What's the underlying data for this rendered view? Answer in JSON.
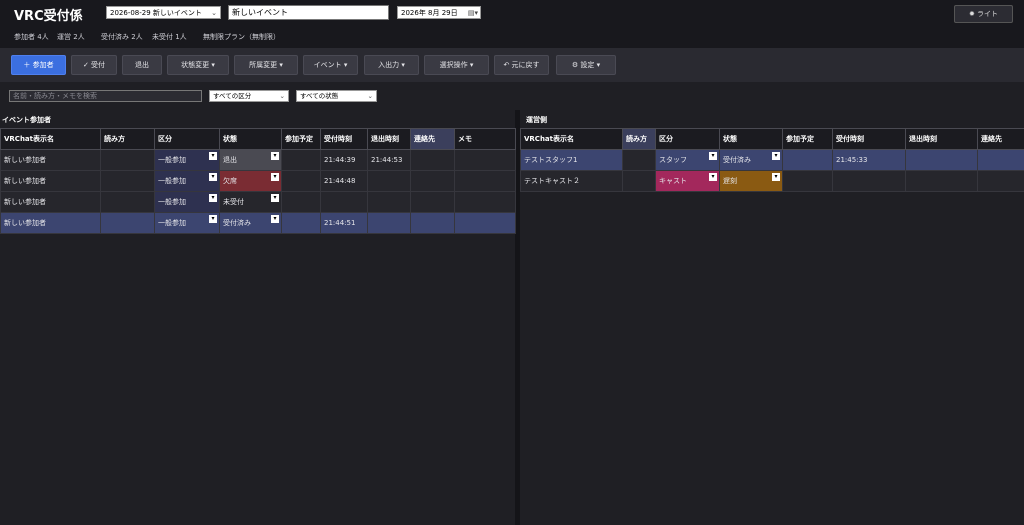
{
  "header": {
    "title": "VRC受付係",
    "event_select": "2026-08-29  新しいイベント",
    "event_name": "新しいイベント",
    "date": "2026年  8月 29日",
    "theme_button": "ライト",
    "stats": {
      "participants": "参加者 4人",
      "staff": "運営 2人",
      "checked_in": "受付済み 2人",
      "not_checked_in": "未受付 1人",
      "plan": "無制限プラン（無制限）"
    }
  },
  "toolbar": {
    "add_participant": "＋ 参加者",
    "check_in": "✓ 受付",
    "leave": "退出",
    "status_change": "状態変更",
    "affiliation_change": "所属変更",
    "event": "イベント",
    "import_export": "入出力",
    "selection_ops": "選択操作",
    "undo": "元に戻す",
    "settings": "設定"
  },
  "filters": {
    "search_placeholder": "名前・読み方・メモを検索",
    "category": "すべての区分",
    "status": "すべての状態"
  },
  "participants": {
    "title": "イベント参加者",
    "columns": [
      "VRChat表示名",
      "読み方",
      "区分",
      "状態",
      "参加予定",
      "受付時刻",
      "退出時刻",
      "連絡先",
      "メモ"
    ],
    "rows": [
      {
        "name": "新しい参加者",
        "reading": "",
        "category": "一般参加",
        "status": "退出",
        "planned": "",
        "checkin": "21:44:39",
        "leave": "21:44:53",
        "contact": "",
        "memo": ""
      },
      {
        "name": "新しい参加者",
        "reading": "",
        "category": "一般参加",
        "status": "欠席",
        "planned": "",
        "checkin": "21:44:48",
        "leave": "",
        "contact": "",
        "memo": ""
      },
      {
        "name": "新しい参加者",
        "reading": "",
        "category": "一般参加",
        "status": "未受付",
        "planned": "",
        "checkin": "",
        "leave": "",
        "contact": "",
        "memo": ""
      },
      {
        "name": "新しい参加者",
        "reading": "",
        "category": "一般参加",
        "status": "受付済み",
        "planned": "",
        "checkin": "21:44:51",
        "leave": "",
        "contact": "",
        "memo": ""
      }
    ]
  },
  "staff": {
    "title": "運営側",
    "columns": [
      "VRChat表示名",
      "読み方",
      "区分",
      "状態",
      "参加予定",
      "受付時刻",
      "退出時刻",
      "連絡先"
    ],
    "rows": [
      {
        "name": "テストスタッフ1",
        "reading": "",
        "category": "スタッフ",
        "status": "受付済み",
        "planned": "",
        "checkin": "21:45:33",
        "leave": "",
        "contact": ""
      },
      {
        "name": "テストキャスト２",
        "reading": "",
        "category": "キャスト",
        "status": "遅刻",
        "planned": "",
        "checkin": "",
        "leave": "",
        "contact": ""
      }
    ]
  },
  "icons": {
    "dropdown": "▾",
    "calendar": "calendar-icon",
    "sun": "☀"
  }
}
